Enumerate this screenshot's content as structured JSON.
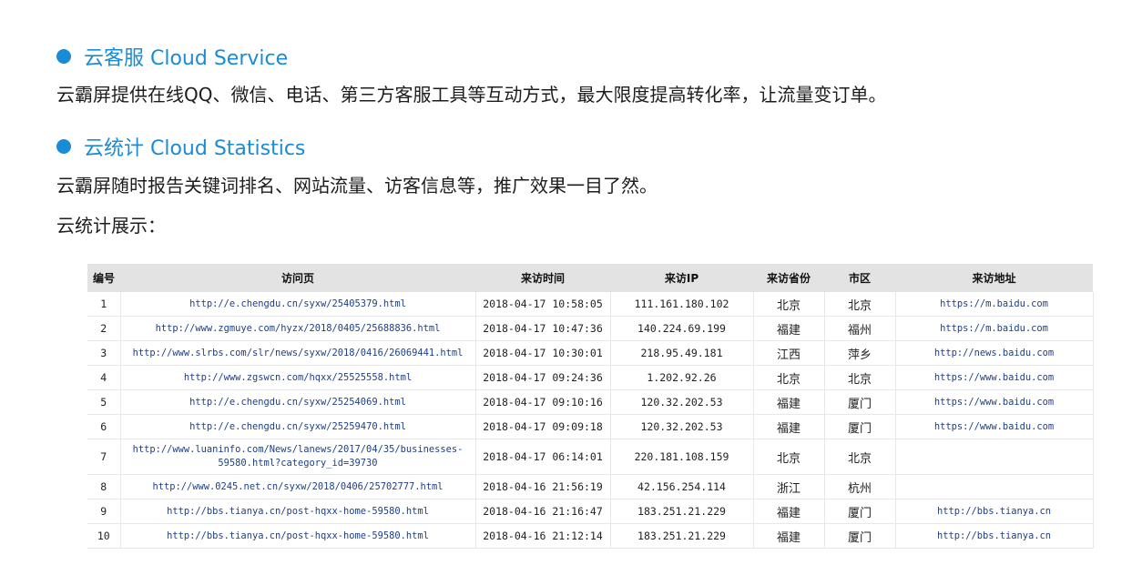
{
  "cloud_service": {
    "heading": "云客服 Cloud Service",
    "text": "云霸屏提供在线QQ、微信、电话、第三方客服工具等互动方式，最大限度提高转化率，让流量变订单。"
  },
  "cloud_statistics": {
    "heading": "云统计 Cloud Statistics",
    "text": "云霸屏随时报告关键词排名、网站流量、访客信息等，推广效果一目了然。",
    "display_label": "云统计展示："
  },
  "table": {
    "headers": [
      "编号",
      "访问页",
      "来访时间",
      "来访IP",
      "来访省份",
      "市区",
      "来访地址"
    ],
    "rows": [
      {
        "id": "1",
        "page": "http://e.chengdu.cn/syxw/25405379.html",
        "time": "2018-04-17 10:58:05",
        "ip": "111.161.180.102",
        "province": "北京",
        "city": "北京",
        "source": "https://m.baidu.com"
      },
      {
        "id": "2",
        "page": "http://www.zgmuye.com/hyzx/2018/0405/25688836.html",
        "time": "2018-04-17 10:47:36",
        "ip": "140.224.69.199",
        "province": "福建",
        "city": "福州",
        "source": "https://m.baidu.com"
      },
      {
        "id": "3",
        "page": "http://www.slrbs.com/slr/news/syxw/2018/0416/26069441.html",
        "time": "2018-04-17 10:30:01",
        "ip": "218.95.49.181",
        "province": "江西",
        "city": "萍乡",
        "source": "http://news.baidu.com"
      },
      {
        "id": "4",
        "page": "http://www.zgswcn.com/hqxx/25525558.html",
        "time": "2018-04-17 09:24:36",
        "ip": "1.202.92.26",
        "province": "北京",
        "city": "北京",
        "source": "https://www.baidu.com"
      },
      {
        "id": "5",
        "page": "http://e.chengdu.cn/syxw/25254069.html",
        "time": "2018-04-17 09:10:16",
        "ip": "120.32.202.53",
        "province": "福建",
        "city": "厦门",
        "source": "https://www.baidu.com"
      },
      {
        "id": "6",
        "page": "http://e.chengdu.cn/syxw/25259470.html",
        "time": "2018-04-17 09:09:18",
        "ip": "120.32.202.53",
        "province": "福建",
        "city": "厦门",
        "source": "https://www.baidu.com"
      },
      {
        "id": "7",
        "page": "http://www.luaninfo.com/News/lanews/2017/04/35/businesses-59580.html?category_id=39730",
        "time": "2018-04-17 06:14:01",
        "ip": "220.181.108.159",
        "province": "北京",
        "city": "北京",
        "source": ""
      },
      {
        "id": "8",
        "page": "http://www.0245.net.cn/syxw/2018/0406/25702777.html",
        "time": "2018-04-16 21:56:19",
        "ip": "42.156.254.114",
        "province": "浙江",
        "city": "杭州",
        "source": ""
      },
      {
        "id": "9",
        "page": "http://bbs.tianya.cn/post-hqxx-home-59580.html",
        "time": "2018-04-16 21:16:47",
        "ip": "183.251.21.229",
        "province": "福建",
        "city": "厦门",
        "source": "http://bbs.tianya.cn"
      },
      {
        "id": "10",
        "page": "http://bbs.tianya.cn/post-hqxx-home-59580.html",
        "time": "2018-04-16 21:12:14",
        "ip": "183.251.21.229",
        "province": "福建",
        "city": "厦门",
        "source": "http://bbs.tianya.cn"
      }
    ]
  },
  "colors": {
    "accent": "#1a8bd6",
    "link": "#1e3f86",
    "header_bg": "#e3e3e3"
  }
}
